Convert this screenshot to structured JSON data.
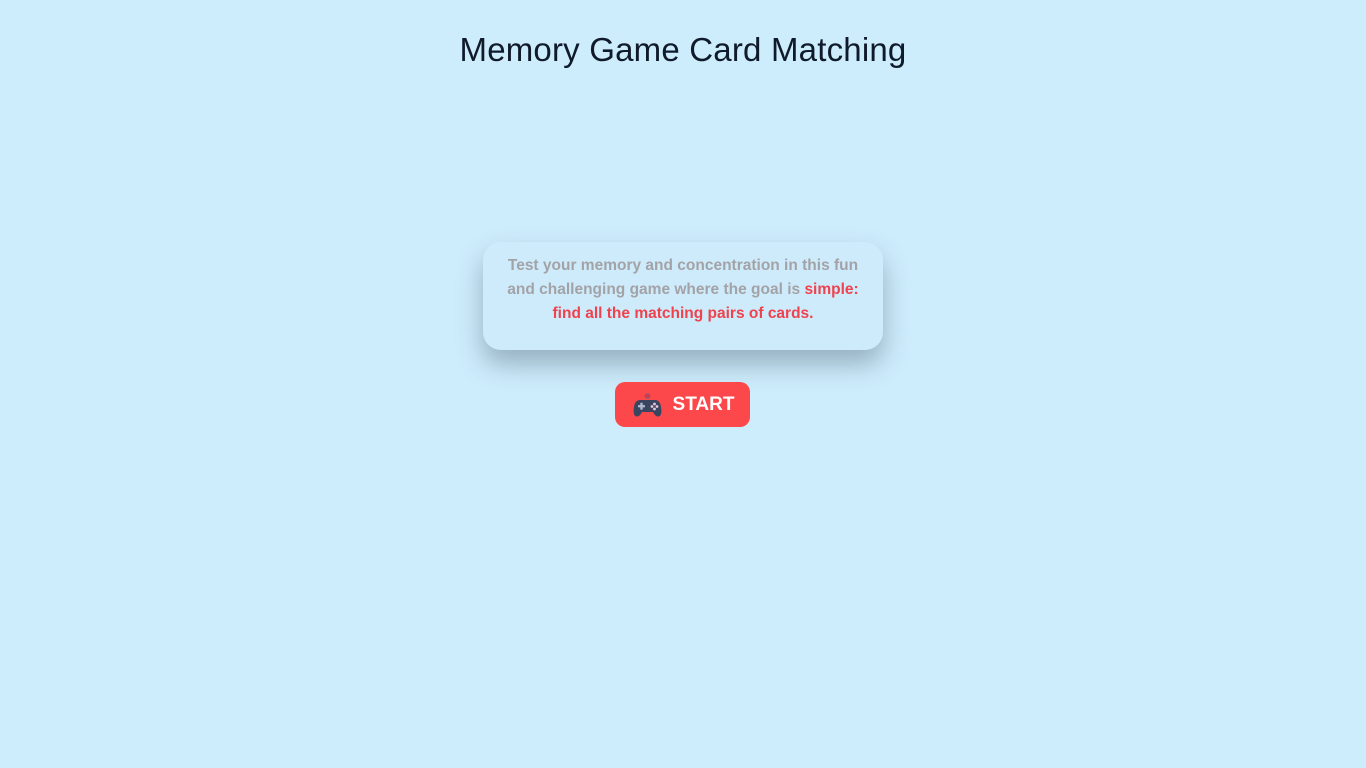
{
  "page": {
    "title": "Memory Game Card Matching"
  },
  "intro": {
    "text_plain": "Test your memory and concentration in this fun and challenging game where the goal is ",
    "text_highlight": "simple: find all the matching pairs of cards."
  },
  "start_button": {
    "label": "START",
    "icon": "gamepad-icon"
  },
  "colors": {
    "background": "#cdecfc",
    "accent": "#fc474b",
    "highlight_text": "#f0424c",
    "muted_text": "#a3a3a7",
    "title_text": "#0f1a2b"
  }
}
